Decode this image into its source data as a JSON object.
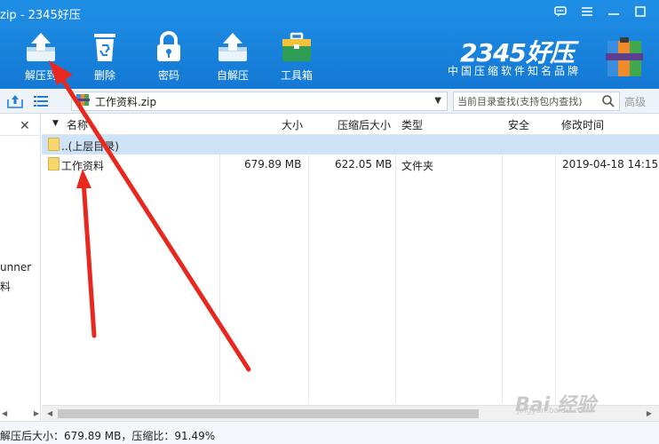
{
  "window": {
    "title": "zip - 2345好压",
    "buttons": [
      "message-icon",
      "menu-icon",
      "minimize-icon",
      "maximize-icon"
    ]
  },
  "toolbar": {
    "items": [
      {
        "label": "解压到",
        "icon": "extract-to-icon"
      },
      {
        "label": "删除",
        "icon": "recycle-bin-icon"
      },
      {
        "label": "密码",
        "icon": "lock-icon"
      },
      {
        "label": "自解压",
        "icon": "self-extract-icon"
      },
      {
        "label": "工具箱",
        "icon": "toolbox-icon"
      }
    ]
  },
  "brand": {
    "name": "2345好压",
    "slogan": "中国压缩软件知名品牌"
  },
  "addressbar": {
    "path": "工作资料.zip",
    "search_placeholder": "当前目录查找(支持包内查找)",
    "advanced": "高级"
  },
  "leftpane": {
    "text1": "unner",
    "text2": "料"
  },
  "table": {
    "columns": [
      "名称",
      "大小",
      "压缩后大小",
      "类型",
      "安全",
      "修改时间"
    ],
    "rows": [
      {
        "name": "..(上层目录)",
        "size": "",
        "packed": "",
        "type": "",
        "security": "",
        "modified": "",
        "selected": true
      },
      {
        "name": "工作资料",
        "size": "679.89 MB",
        "packed": "622.05 MB",
        "type": "文件夹",
        "security": "",
        "modified": "2019-04-18 14:15:",
        "selected": false
      }
    ]
  },
  "statusbar": {
    "text": "解压后大小：679.89 MB，压缩比：91.49%"
  },
  "watermark": {
    "text": "Bai 经验",
    "url": "jingyan.baidu.com"
  },
  "colors": {
    "toolbar_blue": "#1a84dd",
    "selected_row": "#cfe3f7",
    "annotation_red": "#e8281e"
  }
}
